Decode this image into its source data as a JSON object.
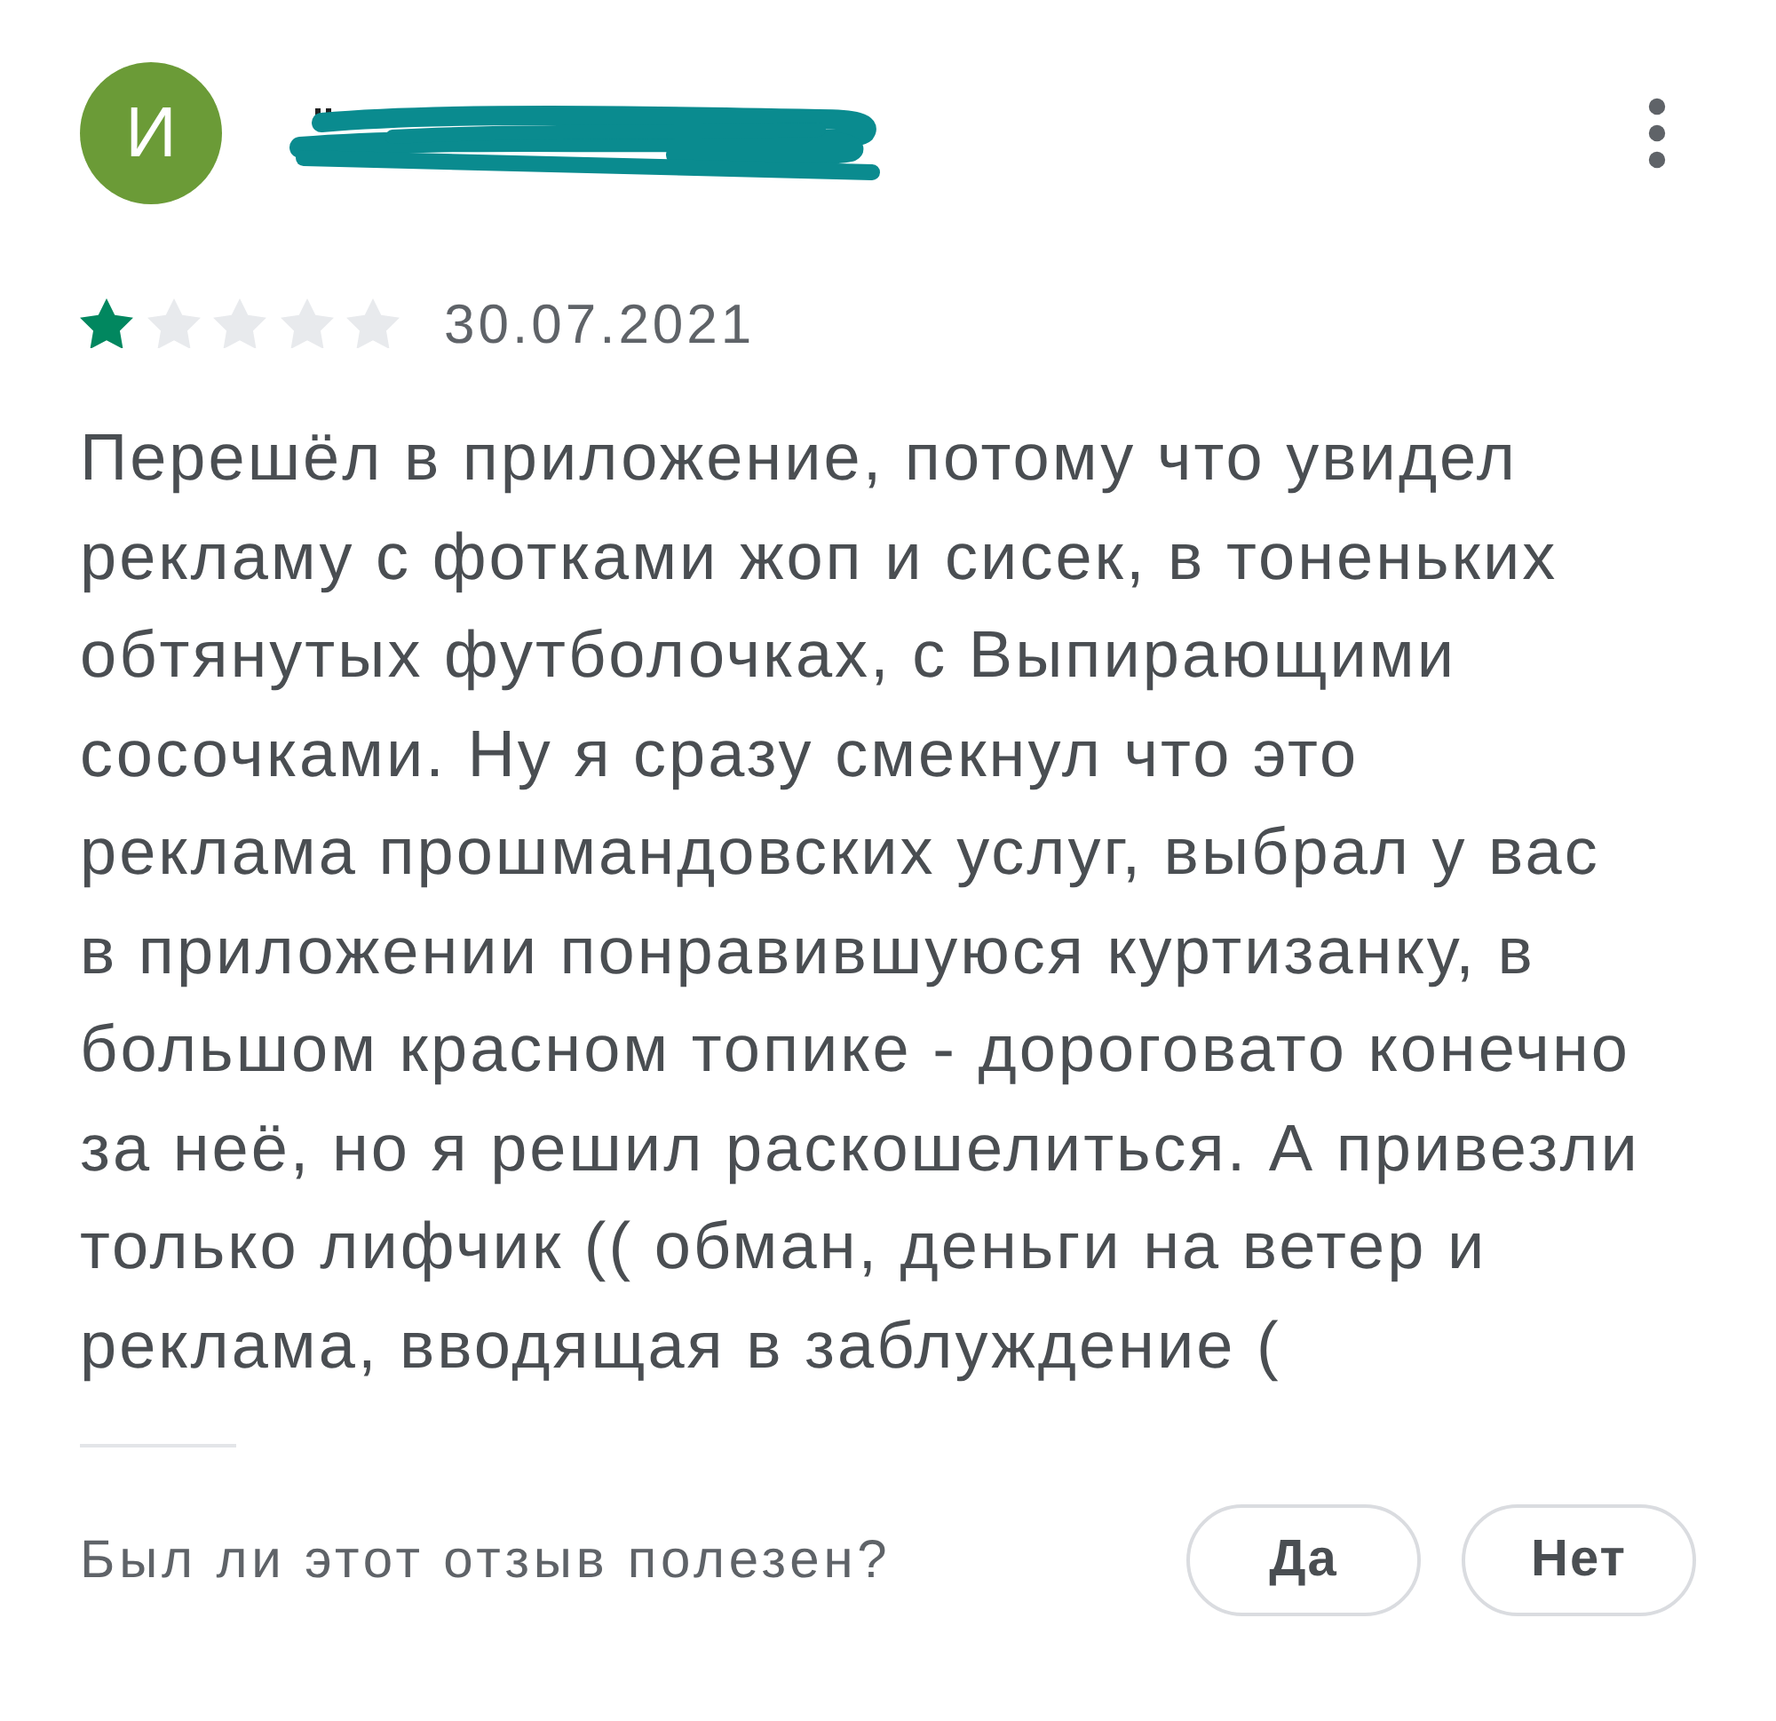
{
  "review": {
    "author": {
      "avatar_letter": "И",
      "redacted": true
    },
    "stars": 1,
    "date": "30.07.2021",
    "text_lines": [
      "Перешёл в приложение, потому что увидел",
      "рекламу с фотками жоп и сисек, в тоненьких",
      "обтянутых футболочках, с Выпирающими",
      "сосочками. Ну я сразу смекнул что это",
      "реклама прошмандовских услуг, выбрал у вас",
      "в приложении понравившуюся куртизанку, в",
      "большом красном топике - дороговато конечно",
      "за неё, но я решил раскошелиться. А привезли",
      "только лифчик (( обман, деньги на ветер и",
      "реклама, вводящая в заблуждение ("
    ]
  },
  "helpful": {
    "question": "Был ли этот отзыв полезен?",
    "buttons": [
      "Да",
      "Нет"
    ]
  }
}
